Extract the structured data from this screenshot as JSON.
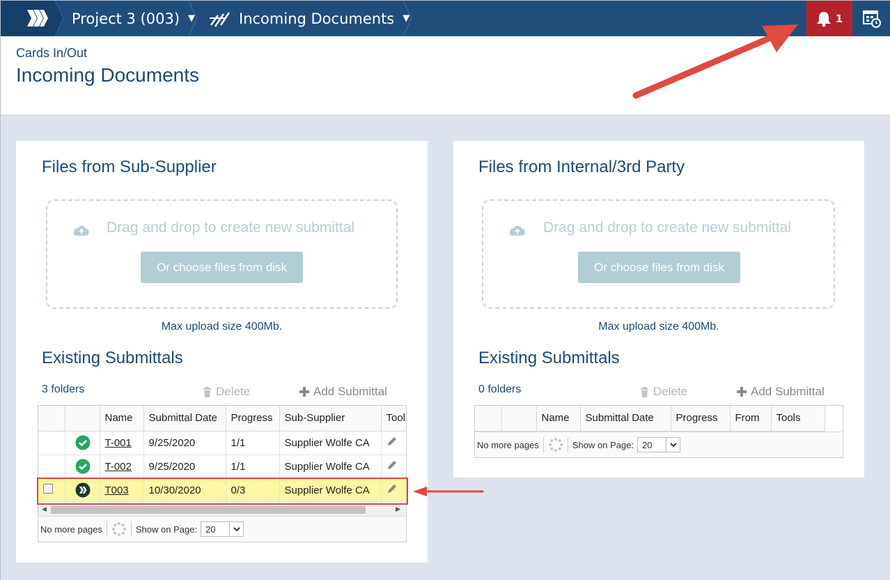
{
  "topbar": {
    "project": "Project 3 (003)",
    "section": "Incoming Documents",
    "notifications_count": "1",
    "colors": {
      "bar": "#1f4e7d",
      "notification": "#b5222a"
    }
  },
  "header": {
    "subtitle": "Cards In/Out",
    "title": "Incoming Documents"
  },
  "left_panel": {
    "title": "Files from Sub-Supplier",
    "dropzone_text": "Drag and drop to create new submittal",
    "choose_button": "Or choose files from disk",
    "max_upload": "Max upload size 400Mb.",
    "existing_title": "Existing Submittals",
    "folders_count": "3 folders",
    "delete_label": "Delete",
    "add_label": "Add Submittal",
    "columns": [
      "Name",
      "Submittal Date",
      "Progress",
      "Sub-Supplier",
      "Tool"
    ],
    "rows": [
      {
        "name": "T-001",
        "date": "9/25/2020",
        "progress": "1/1",
        "supplier": "Supplier Wolfe CA",
        "status": "approved"
      },
      {
        "name": "T-002",
        "date": "9/25/2020",
        "progress": "1/1",
        "supplier": "Supplier Wolfe CA",
        "status": "approved"
      },
      {
        "name": "T003",
        "date": "10/30/2020",
        "progress": "0/3",
        "supplier": "Supplier Wolfe CA",
        "status": "in-progress"
      }
    ],
    "pager": {
      "no_more": "No more pages",
      "show_on_page": "Show on Page:",
      "page_size": "20"
    }
  },
  "right_panel": {
    "title": "Files from Internal/3rd Party",
    "dropzone_text": "Drag and drop to create new submittal",
    "choose_button": "Or choose files from disk",
    "max_upload": "Max upload size 400Mb.",
    "existing_title": "Existing Submittals",
    "folders_count": "0 folders",
    "delete_label": "Delete",
    "add_label": "Add Submittal",
    "columns": [
      "Name",
      "Submittal Date",
      "Progress",
      "From",
      "Tools"
    ],
    "pager": {
      "no_more": "No more pages",
      "show_on_page": "Show on Page:",
      "page_size": "20"
    }
  }
}
